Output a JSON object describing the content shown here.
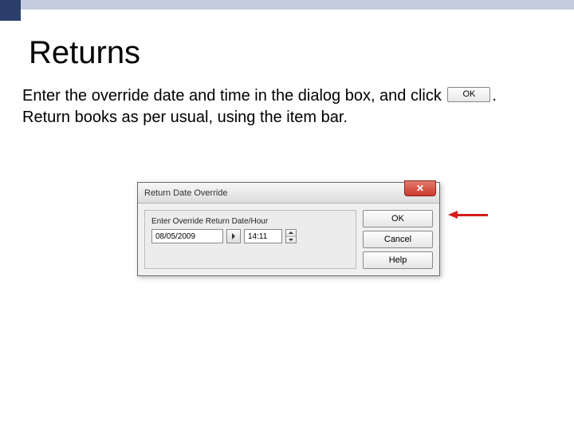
{
  "heading": "Returns",
  "instruction": {
    "part1": "Enter the override date and time in the dialog box, and click",
    "inline_button": "OK",
    "part2": ".  Return books as per usual, using the item bar."
  },
  "dialog": {
    "title": "Return Date Override",
    "field_label": "Enter Override Return Date/Hour",
    "date_value": "08/05/2009",
    "time_value": "14:11",
    "buttons": {
      "ok": "OK",
      "cancel": "Cancel",
      "help": "Help"
    }
  }
}
